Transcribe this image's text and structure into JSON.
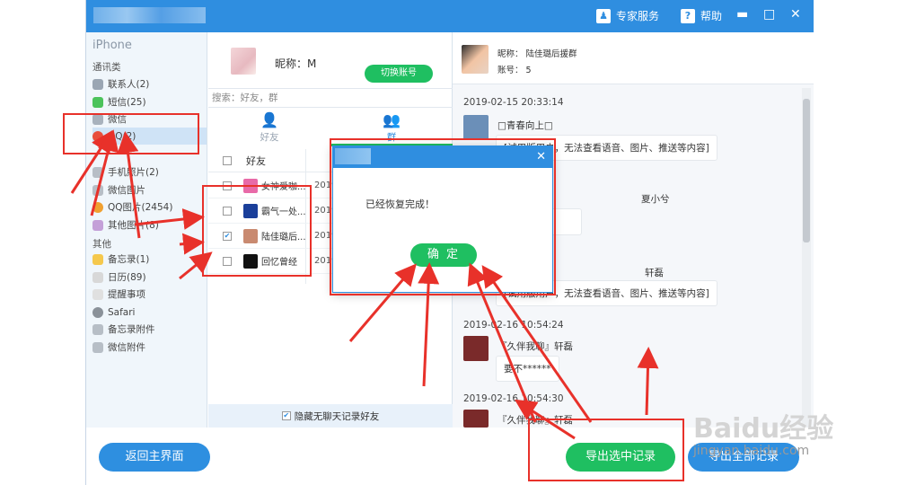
{
  "titlebar": {
    "expert_service": "专家服务",
    "help": "帮助"
  },
  "sidebar": {
    "device": "iPhone",
    "section_contacts": "通讯类",
    "section_other": "其他",
    "items": [
      {
        "label": "联系人(2)",
        "color": "#9aa6b3"
      },
      {
        "label": "短信(25)",
        "color": "#4cc35b"
      },
      {
        "label": "微信",
        "color": "#a8b2bd"
      },
      {
        "label": "QQ(2)",
        "color": "#e94e3c"
      },
      {
        "label": "手机照片(2)",
        "color": "#b7bec6"
      },
      {
        "label": "微信图片",
        "color": "#b7bec6"
      },
      {
        "label": "QQ图片(2454)",
        "color": "#f0a030"
      },
      {
        "label": "其他图片(8)",
        "color": "#c4a0d8"
      },
      {
        "label": "备忘录(1)",
        "color": "#f5c84c"
      },
      {
        "label": "日历(89)",
        "color": "#d8d8d8"
      },
      {
        "label": "提醒事项",
        "color": "#e0e0e0"
      },
      {
        "label": "Safari",
        "color": "#8a9199"
      },
      {
        "label": "备忘录附件",
        "color": "#b7bec6"
      },
      {
        "label": "微信附件",
        "color": "#b7bec6"
      }
    ]
  },
  "account": {
    "nickname": "昵称：M",
    "switch_label": "切换账号",
    "search_placeholder": "搜索：好友，群"
  },
  "tabs": [
    {
      "label": "好友"
    },
    {
      "label": "群"
    }
  ],
  "table": {
    "header": "好友",
    "rows": [
      {
        "name": "女神爱咖...",
        "date": "2019",
        "checked": false,
        "color": "#e86aa8"
      },
      {
        "name": "霸气一处...",
        "date": "2019",
        "checked": false,
        "color": "#1a3f9a"
      },
      {
        "name": "陆佳璐后...",
        "date": "2019",
        "checked": true,
        "color": "#c98a70"
      },
      {
        "name": "回忆曾经",
        "date": "2019",
        "checked": false,
        "color": "#111111"
      }
    ],
    "hide_label": "隐藏无聊天记录好友"
  },
  "chat": {
    "nickname": "昵称：  陆佳璐后援群",
    "account_no": "账号：  5",
    "messages": [
      {
        "time": "2019-02-15 20:33:14",
        "name": "□青春向上□",
        "text": "[试用版用户，无法查看语音、图片、推送等内容]"
      },
      {
        "time": "",
        "name": "夏小兮",
        "text": ""
      },
      {
        "time": "",
        "name": "轩磊",
        "text": "[试用版用户，无法查看语音、图片、推送等内容]"
      },
      {
        "time": "2019-02-16 10:54:24",
        "name": "『久伴我聊』轩磊",
        "text": "要不******"
      },
      {
        "time": "2019-02-16 10:54:30",
        "name": "『久伴我聊』轩磊",
        "text": ""
      }
    ]
  },
  "dialog": {
    "message": "已经恢复完成！",
    "ok_label": "确 定",
    "close": "✕"
  },
  "footer": {
    "back_label": "返回主界面",
    "export_selected_label": "导出选中记录",
    "export_all_label": "导出全部记录"
  },
  "watermark": {
    "brand": "Baidu经验",
    "url": "jingyan.baidu.com"
  }
}
